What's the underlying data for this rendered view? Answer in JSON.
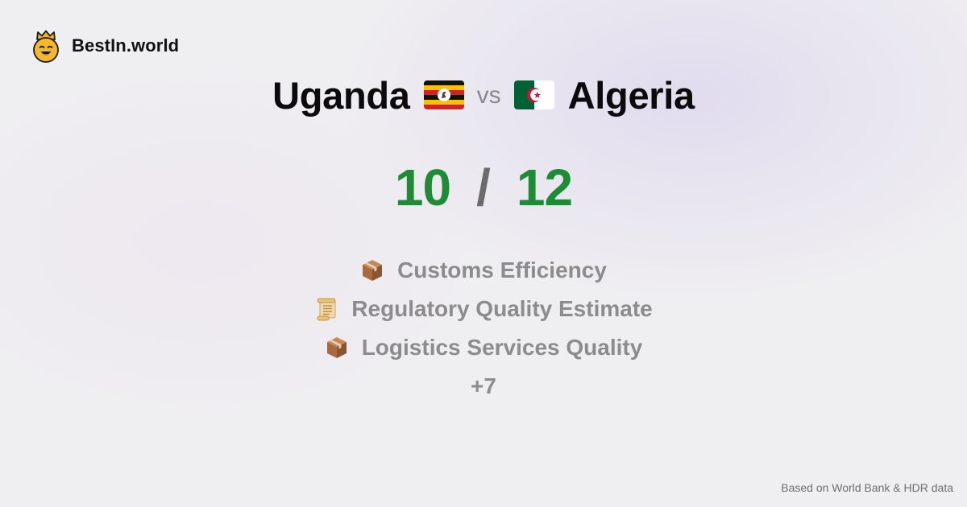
{
  "brand": {
    "name": "BestIn.world",
    "icon": "crowned-smiley-icon"
  },
  "comparison": {
    "left_country": "Uganda",
    "left_flag": "uganda-flag-icon",
    "vs": "vs",
    "right_country": "Algeria",
    "right_flag": "algeria-flag-icon"
  },
  "score": {
    "left": "10",
    "separator": "/",
    "right": "12",
    "color": "#1e8c35"
  },
  "categories": [
    {
      "icon": "package-icon",
      "label": "Customs Efficiency"
    },
    {
      "icon": "scroll-icon",
      "label": "Regulatory Quality Estimate"
    },
    {
      "icon": "package-icon",
      "label": "Logistics Services Quality"
    }
  ],
  "more": "+7",
  "footer": "Based on World Bank & HDR data"
}
